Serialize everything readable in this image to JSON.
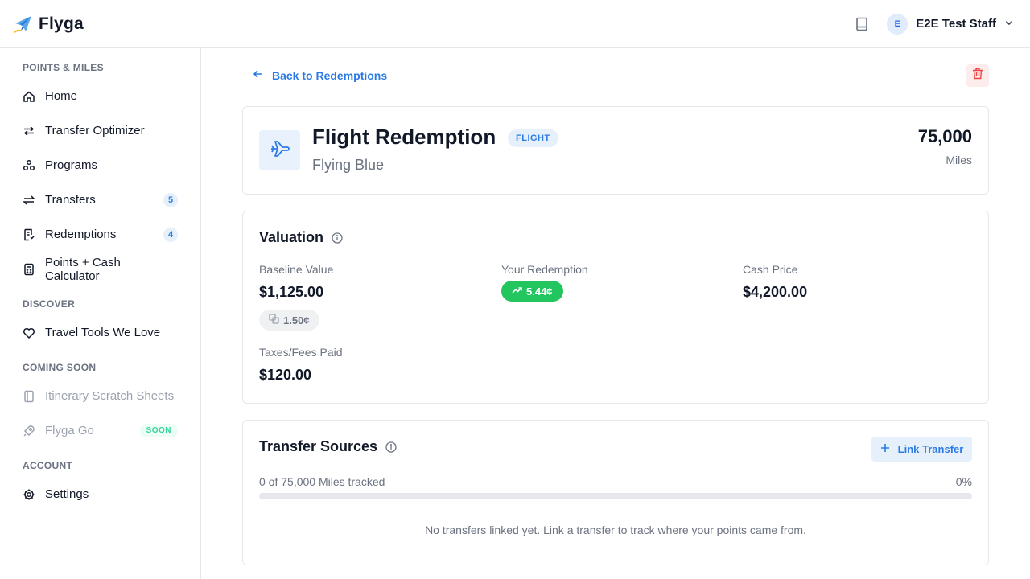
{
  "header": {
    "brand": "Flyga",
    "user": {
      "initial": "E",
      "name": "E2E Test Staff"
    },
    "icons": [
      "book-icon",
      "chevron-down-icon"
    ]
  },
  "sidebar": {
    "sections": [
      {
        "title": "POINTS & MILES",
        "items": [
          {
            "label": "Home",
            "icon": "home-icon"
          },
          {
            "label": "Transfer Optimizer",
            "icon": "arrows-exchange-icon"
          },
          {
            "label": "Programs",
            "icon": "programs-icon"
          },
          {
            "label": "Transfers",
            "icon": "transfer-icon",
            "count": "5"
          },
          {
            "label": "Redemptions",
            "icon": "receipt-icon",
            "count": "4"
          },
          {
            "label": "Points + Cash Calculator",
            "icon": "calculator-icon"
          }
        ]
      },
      {
        "title": "DISCOVER",
        "items": [
          {
            "label": "Travel Tools We Love",
            "icon": "heart-icon"
          }
        ]
      },
      {
        "title": "COMING SOON",
        "items": [
          {
            "label": "Itinerary Scratch Sheets",
            "icon": "notebook-icon",
            "disabled": true
          },
          {
            "label": "Flyga Go",
            "icon": "rocket-icon",
            "disabled": true,
            "badge": "SOON"
          }
        ]
      },
      {
        "title": "ACCOUNT",
        "items": [
          {
            "label": "Settings",
            "icon": "gear-icon"
          }
        ]
      }
    ]
  },
  "main": {
    "back_label": "Back to Redemptions",
    "redemption": {
      "title": "Flight Redemption",
      "type_badge": "FLIGHT",
      "program": "Flying Blue",
      "miles": "75,000",
      "miles_unit": "Miles"
    },
    "valuation": {
      "title": "Valuation",
      "baseline_label": "Baseline Value",
      "baseline_value": "$1,125.00",
      "baseline_cpp": "1.50¢",
      "your_label": "Your Redemption",
      "your_cpp": "5.44¢",
      "cash_label": "Cash Price",
      "cash_value": "$4,200.00",
      "taxes_label": "Taxes/Fees Paid",
      "taxes_value": "$120.00"
    },
    "transfer_sources": {
      "title": "Transfer Sources",
      "link_button": "Link Transfer",
      "tracked_text": "0 of 75,000 Miles tracked",
      "tracked_percent": "0%",
      "progress_fraction": 0,
      "empty_message": "No transfers linked yet. Link a transfer to track where your points came from."
    }
  },
  "colors": {
    "accent": "#2c7be5",
    "success": "#22c55e",
    "danger": "#ef4444",
    "soon": "#34d399"
  }
}
